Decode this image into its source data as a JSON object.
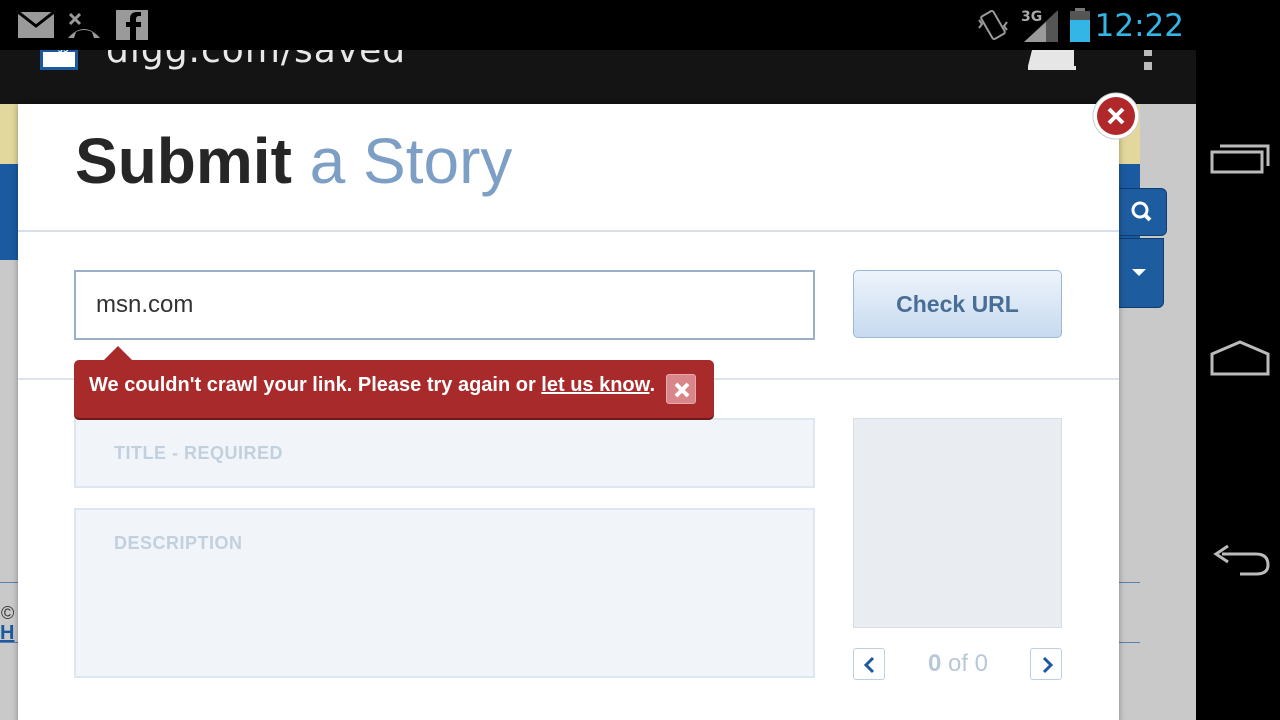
{
  "status_bar": {
    "time": "12:22",
    "network": "3G",
    "accent_color": "#33b5e5",
    "icons": [
      "mail-icon",
      "missed-call-icon",
      "facebook-icon",
      "vibrate-icon",
      "signal-icon",
      "battery-icon"
    ]
  },
  "browser": {
    "url": "digg.com/saved",
    "favicon_text": "digg"
  },
  "modal": {
    "title_bold": "Submit",
    "title_light": "a Story",
    "url_input_value": "msn.com",
    "check_url_label": "Check URL",
    "error": {
      "text_before": "We couldn't crawl your link. Please try again or ",
      "link_text": "let us know",
      "text_after": "."
    },
    "title_placeholder": "TITLE - REQUIRED",
    "description_placeholder": "DESCRIPTION",
    "pager": {
      "current": "0",
      "separator": "of",
      "total": "0"
    }
  },
  "footer": {
    "copyright_fragment": "©",
    "link_fragment": "H"
  },
  "colors": {
    "brand_blue": "#1b5aa0",
    "error_red": "#a82a2a",
    "title_light": "#7d9fc6"
  }
}
